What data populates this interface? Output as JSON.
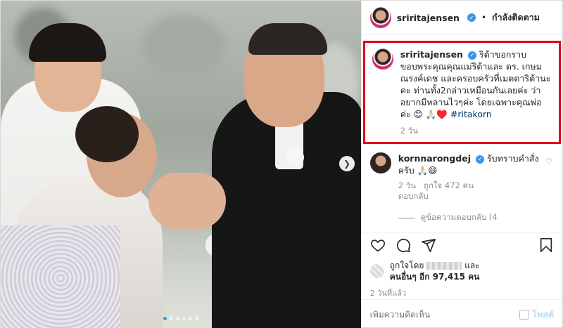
{
  "post": {
    "author": "sriritajensen",
    "follow_status": "กำลังติดตาม",
    "separator": "•"
  },
  "caption": {
    "username": "sriritajensen",
    "text": "ริต้าขอกราบขอบพระคุณคุณแม่ริต้าและ ดร. เกษม ณรงค์เดช และครอบครัวที่เมตตาริต้านะคะ ท่านทั้ง2กล่าวเหมือนกันเลยค่ะ ว่าอยากมีหลานไวๆค่ะ โดยเฉพาะคุณพ่อค่ะ 😊 🙏🏻♥️",
    "hashtag": "#ritakorn",
    "time": "2 วัน"
  },
  "comment": {
    "username": "kornnarongdej",
    "text": "รับทราบคำสั่งครับ 🙏🏻😄",
    "time": "2 วัน",
    "likes": "ถูกใจ 472 คน",
    "reply": "ตอบกลับ"
  },
  "replies_toggle": "ดูข้อความตอบกลับ (4",
  "likes": {
    "prefix": "ถูกใจโดย",
    "suffix": "และ",
    "others": "คนอื่นๆ อีก 97,415 คน"
  },
  "date": "2 วันที่แล้ว",
  "add_comment": {
    "placeholder": "เพิ่มความคิดเห็น",
    "post_label": "โพสต์"
  },
  "carousel": {
    "total_slides": 6,
    "active_slide": 1
  },
  "colors": {
    "highlight_border": "#e0001b",
    "link": "#00376b",
    "verified": "#3897f0"
  },
  "icons": [
    "heart-icon",
    "comment-icon",
    "share-icon",
    "bookmark-icon",
    "chevron-right-icon",
    "verified-icon",
    "emoji-icon"
  ]
}
